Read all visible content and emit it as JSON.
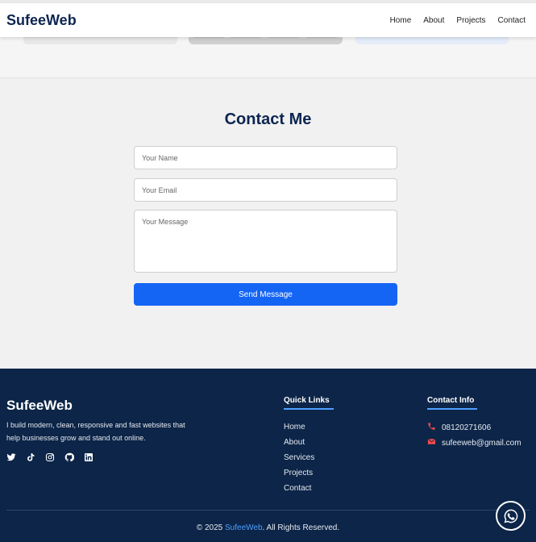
{
  "header": {
    "brand": "SufeeWeb",
    "nav": [
      "Home",
      "About",
      "Projects",
      "Contact"
    ]
  },
  "contact": {
    "title": "Contact Me",
    "name_placeholder": "Your Name",
    "email_placeholder": "Your Email",
    "message_placeholder": "Your Message",
    "submit_label": "Send Message"
  },
  "footer": {
    "brand": "SufeeWeb",
    "tagline": "I build modern, clean, responsive and fast websites that help businesses grow and stand out online.",
    "socials": [
      "twitter-icon",
      "tiktok-icon",
      "instagram-icon",
      "github-icon",
      "linkedin-icon"
    ],
    "quick_links_title": "Quick Links",
    "quick_links": [
      "Home",
      "About",
      "Services",
      "Projects",
      "Contact"
    ],
    "contact_info_title": "Contact Info",
    "phone": "08120271606",
    "email": "sufeeweb@gmail.com",
    "copyright_prefix": "© 2025 ",
    "copyright_brand": "SufeeWeb",
    "copyright_suffix": ". All Rights Reserved."
  },
  "colors": {
    "navy": "#0c2548",
    "accent_blue": "#1565f5",
    "link_blue": "#4ea0ff"
  }
}
